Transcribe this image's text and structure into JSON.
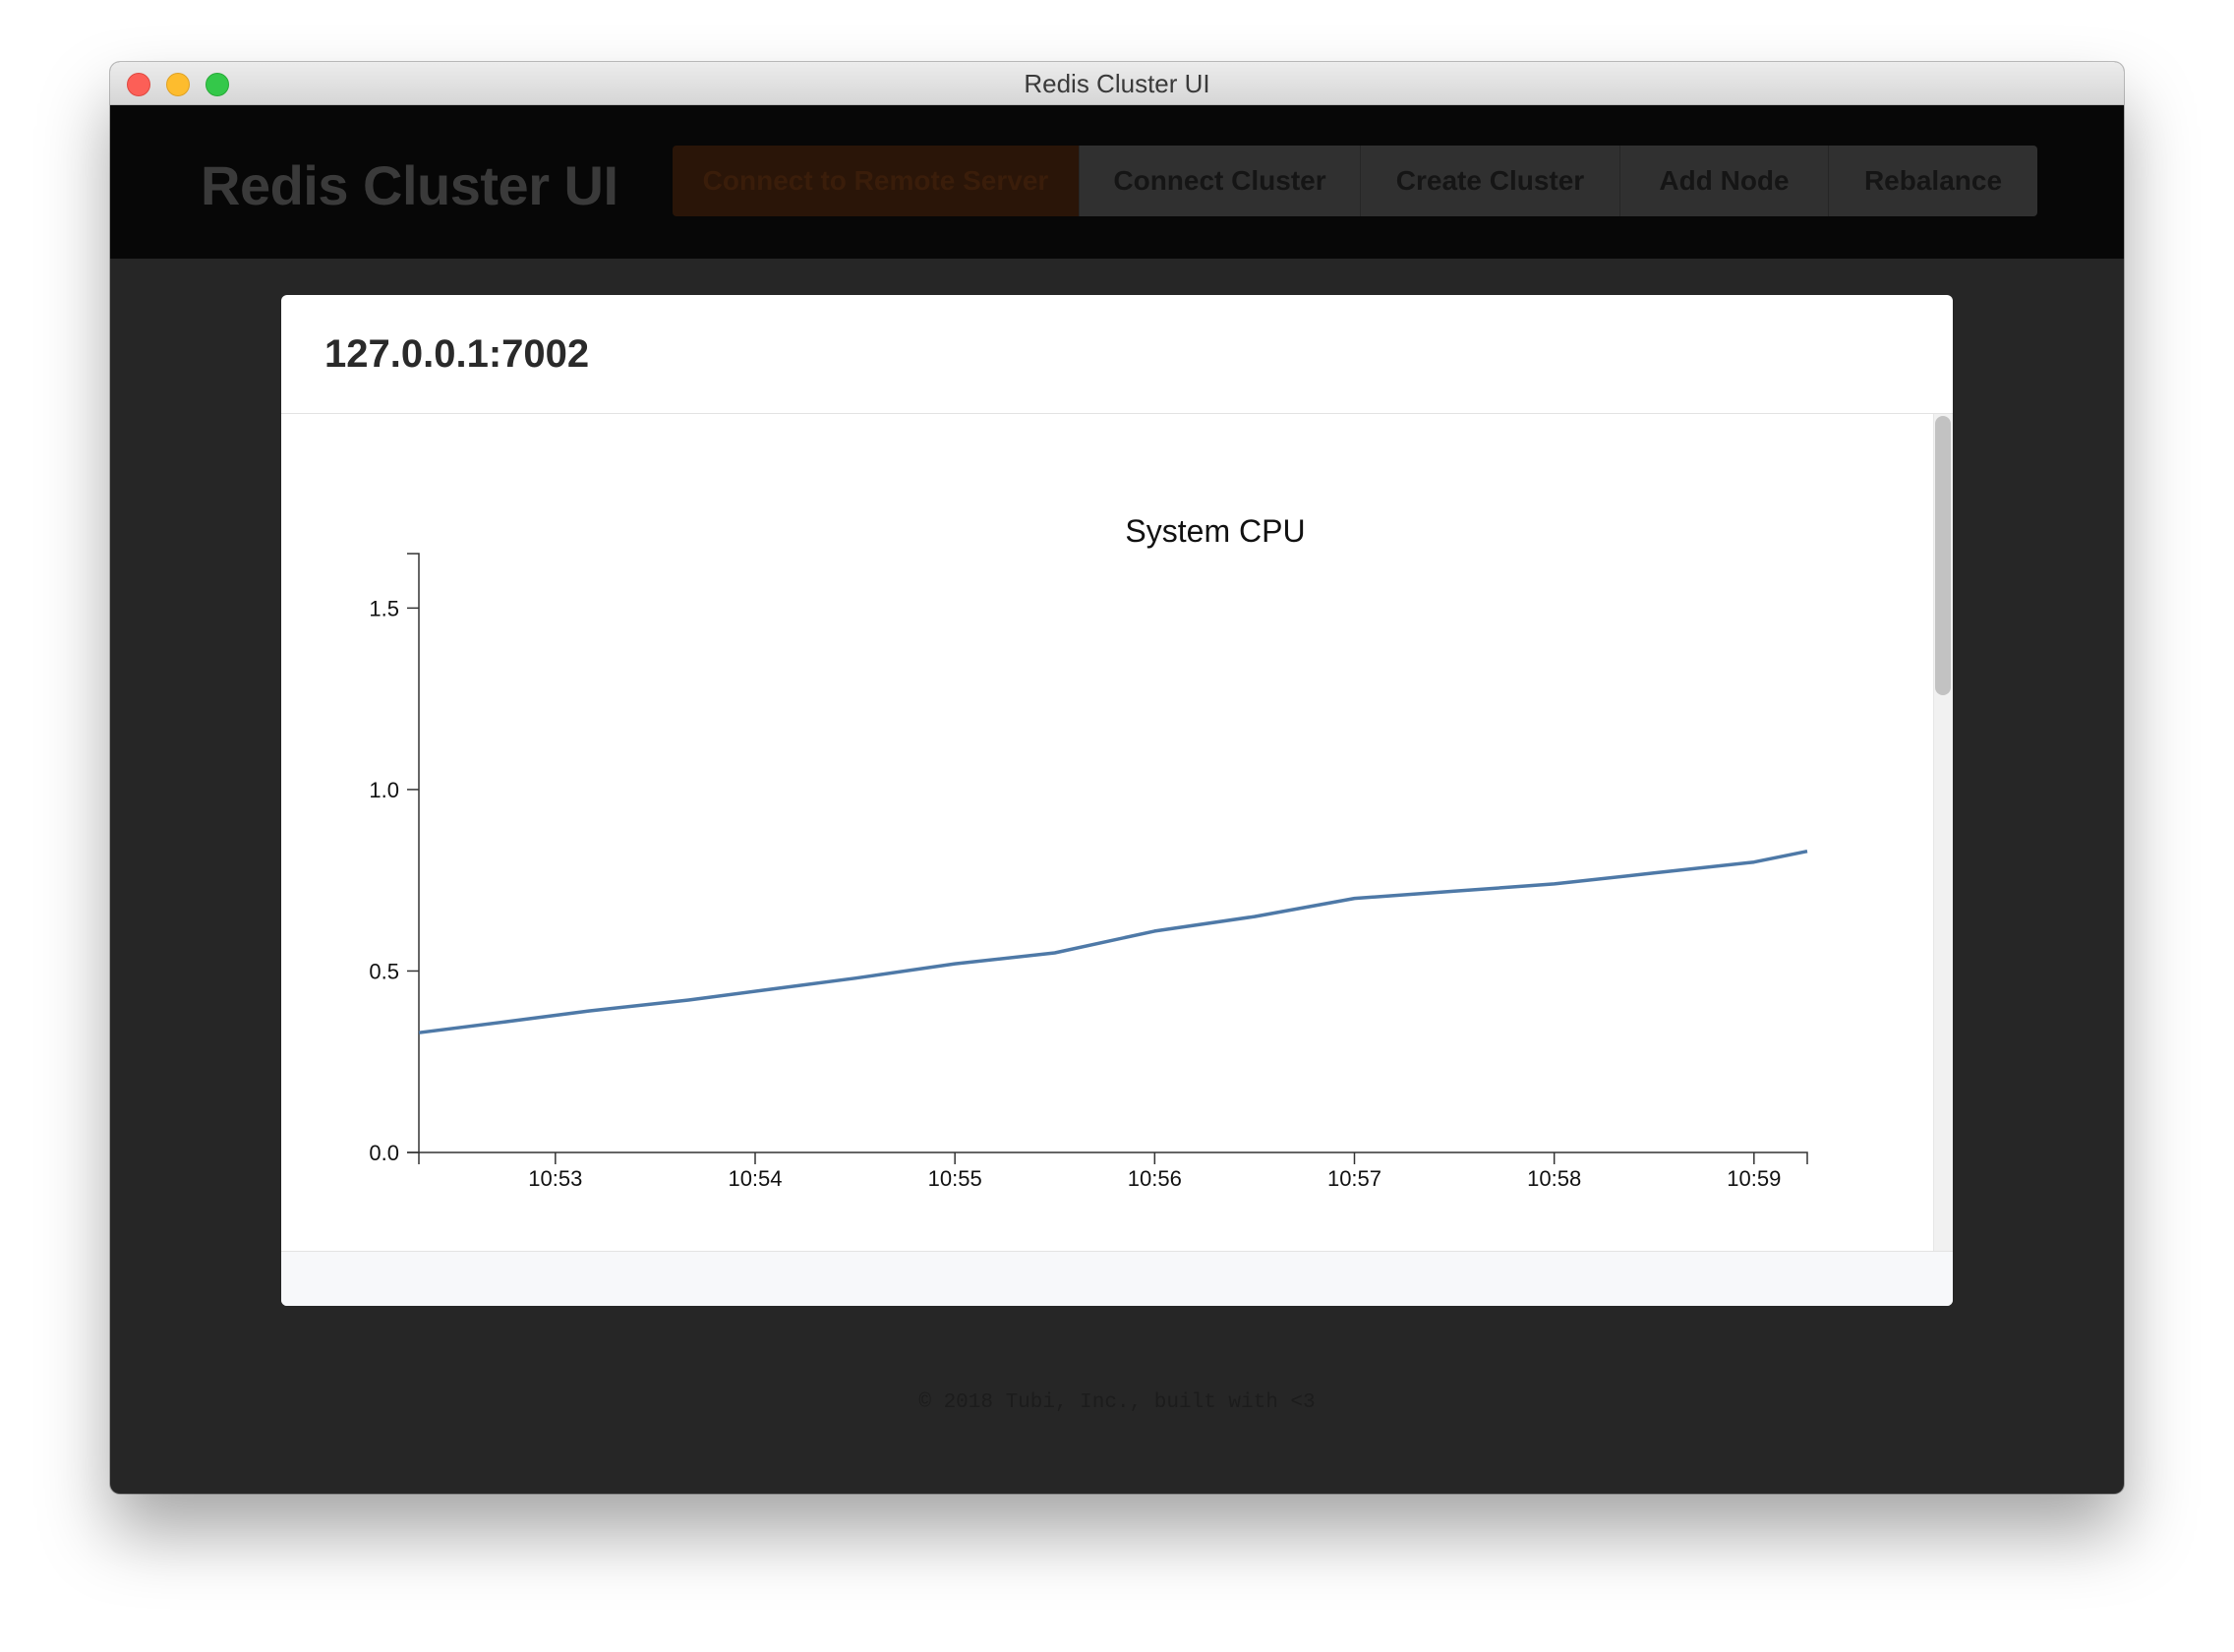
{
  "window": {
    "title": "Redis Cluster UI"
  },
  "header": {
    "brand": "Redis Cluster UI",
    "nav": [
      {
        "label": "Connect to Remote Server"
      },
      {
        "label": "Connect Cluster"
      },
      {
        "label": "Create Cluster"
      },
      {
        "label": "Add Node"
      },
      {
        "label": "Rebalance"
      }
    ]
  },
  "modal": {
    "title": "127.0.0.1:7002"
  },
  "footer": {
    "text": "© 2018 Tubi, Inc., built with <3"
  },
  "colors": {
    "line": "#4e79a7",
    "accent_button": "#2a1508"
  },
  "chart_data": {
    "type": "line",
    "title": "System CPU",
    "xlabel": "",
    "ylabel": "",
    "x_ticks": [
      "10:53",
      "10:54",
      "10:55",
      "10:56",
      "10:57",
      "10:58",
      "10:59"
    ],
    "y_ticks": [
      "0.0",
      "0.5",
      "1.0",
      "1.5"
    ],
    "xlim": [
      "10:52:19",
      "10:59:16"
    ],
    "ylim": [
      0,
      1.65
    ],
    "grid": false,
    "series": [
      {
        "x": [
          "10:52:19",
          "10:52:45",
          "10:53:10",
          "10:53:40",
          "10:54:05",
          "10:54:30",
          "10:55:00",
          "10:55:30",
          "10:56:00",
          "10:56:30",
          "10:57:00",
          "10:57:30",
          "10:58:00",
          "10:58:30",
          "10:59:00",
          "10:59:16"
        ],
        "values": [
          0.33,
          0.36,
          0.39,
          0.42,
          0.45,
          0.48,
          0.52,
          0.55,
          0.61,
          0.65,
          0.7,
          0.72,
          0.74,
          0.77,
          0.8,
          0.83
        ]
      }
    ]
  }
}
